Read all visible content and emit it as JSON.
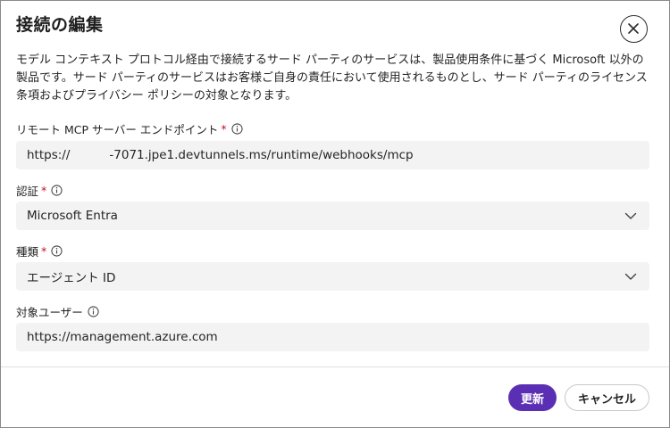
{
  "dialog": {
    "title": "接続の編集",
    "description": "モデル コンテキスト プロトコル経由で接続するサード パーティのサービスは、製品使用条件に基づく Microsoft 以外の製品です。サード パーティのサービスはお客様ご自身の責任において使用されるものとし、サード パーティのライセンス条項およびプライバシー ポリシーの対象となります。"
  },
  "fields": {
    "endpoint": {
      "label": "リモート MCP サーバー エンドポイント",
      "required_mark": "*",
      "value_prefix": "https://",
      "value_rest": "-7071.jpe1.devtunnels.ms/runtime/webhooks/mcp"
    },
    "auth": {
      "label": "認証",
      "required_mark": "*",
      "value": "Microsoft Entra"
    },
    "type": {
      "label": "種類",
      "required_mark": "*",
      "value": "エージェント ID"
    },
    "audience": {
      "label": "対象ユーザー",
      "value": "https://management.azure.com"
    }
  },
  "footer": {
    "update_label": "更新",
    "cancel_label": "キャンセル"
  },
  "icons": {
    "close": "close-icon",
    "info": "info-icon",
    "chevron": "chevron-down-icon"
  },
  "colors": {
    "primary": "#5b2fb3",
    "required": "#c50f1f",
    "field_bg": "#f3f3f3"
  }
}
